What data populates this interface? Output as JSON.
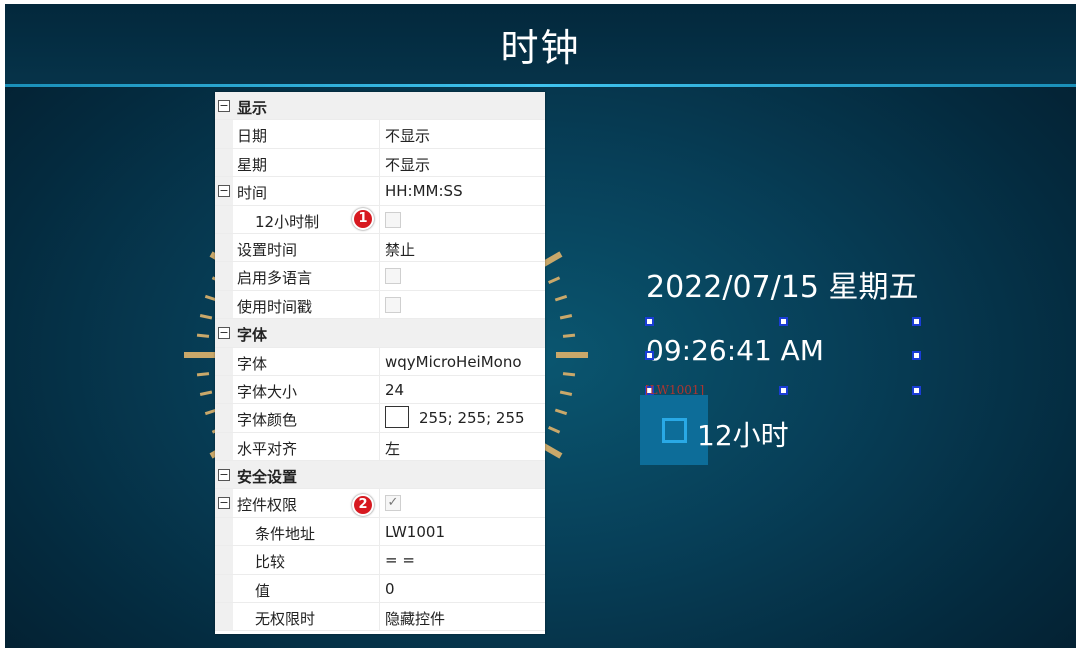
{
  "screen": {
    "title": "时钟"
  },
  "property_grid": {
    "display": {
      "category": "显示",
      "date_name": "日期",
      "date_value": "不显示",
      "weekday_name": "星期",
      "weekday_value": "不显示",
      "time_name": "时间",
      "time_value": "HH:MM:SS",
      "hour12_name": "12小时制",
      "set_time_name": "设置时间",
      "set_time_value": "禁止",
      "multilang_name": "启用多语言",
      "timestamp_name": "使用时间戳"
    },
    "font": {
      "category": "字体",
      "font_name": "字体",
      "font_value": "wqyMicroHeiMono",
      "size_name": "字体大小",
      "size_value": "24",
      "color_name": "字体颜色",
      "color_value": "255; 255; 255",
      "align_name": "水平对齐",
      "align_value": "左"
    },
    "security": {
      "category": "安全设置",
      "permission_name": "控件权限",
      "permission_check": "✓",
      "addr_name": "条件地址",
      "addr_value": "LW1001",
      "compare_name": "比较",
      "compare_value": "= =",
      "value_name": "值",
      "value_value": "0",
      "noperm_name": "无权限时",
      "noperm_value": "隐藏控件"
    },
    "collapse_glyph": "−"
  },
  "annotations": {
    "badge1": "1",
    "badge2": "2"
  },
  "clock": {
    "date": "2022/07/15 星期五",
    "time": "09:26:41 AM",
    "address_tag": "[LW1001]",
    "checkbox_label": "12小时"
  },
  "colors": {
    "background": "#073f58",
    "header_line": "#40c4ef",
    "tick": "#c9a86a",
    "badge": "#d71920",
    "handle_border": "#1a3dd6",
    "checkbox_bg": "#0d6d99"
  }
}
